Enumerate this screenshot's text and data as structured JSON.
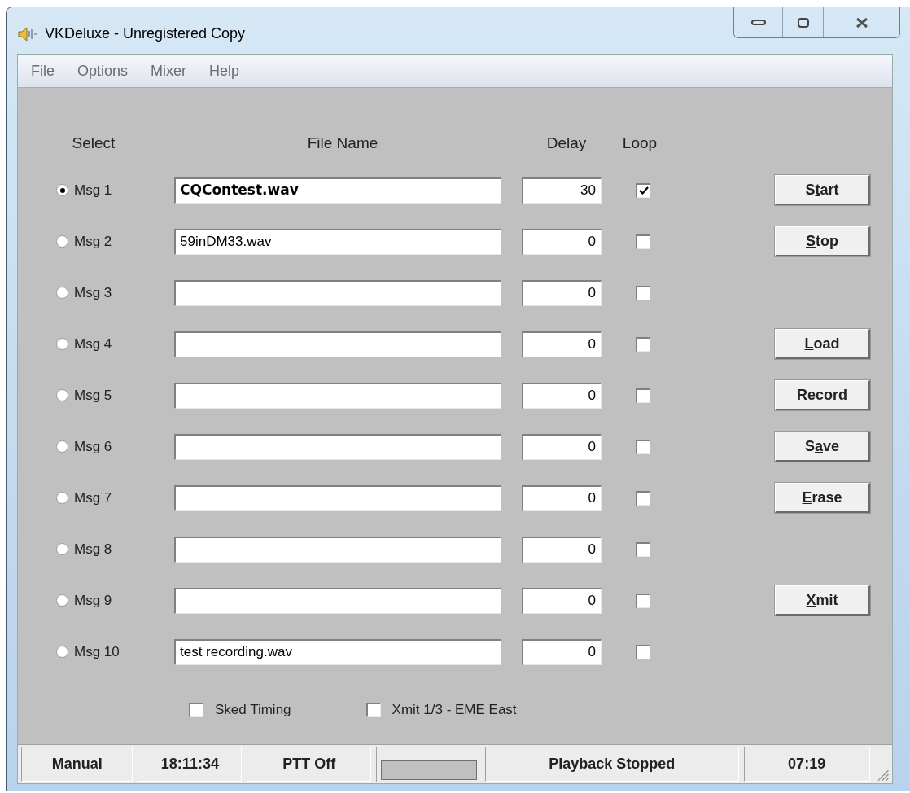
{
  "window": {
    "title": "VKDeluxe - Unregistered Copy"
  },
  "menu": [
    "File",
    "Options",
    "Mixer",
    "Help"
  ],
  "columns": {
    "select": "Select",
    "file_name": "File Name",
    "delay": "Delay",
    "loop": "Loop"
  },
  "messages": [
    {
      "label": "Msg 1",
      "selected": true,
      "file": {
        "text": "CQContest.wav",
        "bold": true
      },
      "delay": "30",
      "loop": true,
      "button": {
        "before": "S",
        "key": "t",
        "after": "art"
      }
    },
    {
      "label": "Msg 2",
      "selected": false,
      "file": {
        "text": "59inDM33.wav",
        "bold": false
      },
      "delay": "0",
      "loop": false,
      "button": {
        "key": "S",
        "after": "top"
      }
    },
    {
      "label": "Msg 3",
      "selected": false,
      "delay": "0",
      "loop": false
    },
    {
      "label": "Msg 4",
      "selected": false,
      "delay": "0",
      "loop": false,
      "button": {
        "key": "L",
        "after": "oad"
      }
    },
    {
      "label": "Msg 5",
      "selected": false,
      "delay": "0",
      "loop": false,
      "button": {
        "key": "R",
        "after": "ecord"
      }
    },
    {
      "label": "Msg 6",
      "selected": false,
      "delay": "0",
      "loop": false,
      "button": {
        "before": "S",
        "key": "a",
        "after": "ve"
      }
    },
    {
      "label": "Msg 7",
      "selected": false,
      "delay": "0",
      "loop": false,
      "button": {
        "key": "E",
        "after": "rase"
      }
    },
    {
      "label": "Msg 8",
      "selected": false,
      "delay": "0",
      "loop": false
    },
    {
      "label": "Msg 9",
      "selected": false,
      "delay": "0",
      "loop": false,
      "button": {
        "key": "X",
        "after": "mit"
      }
    },
    {
      "label": "Msg 10",
      "selected": false,
      "file": {
        "text": "test recording.wav",
        "bold": false
      },
      "delay": "0",
      "loop": false
    }
  ],
  "options": [
    {
      "label": "Sked Timing",
      "checked": false
    },
    {
      "label": "Xmit 1/3 - EME East",
      "checked": false
    }
  ],
  "status_bar": [
    {
      "kind": "text",
      "text": "Manual"
    },
    {
      "kind": "text",
      "text": "18:11:34"
    },
    {
      "kind": "text",
      "text": "PTT Off"
    },
    {
      "kind": "indicator"
    },
    {
      "kind": "text",
      "text": "Playback Stopped"
    },
    {
      "kind": "text",
      "text": "07:19"
    }
  ]
}
